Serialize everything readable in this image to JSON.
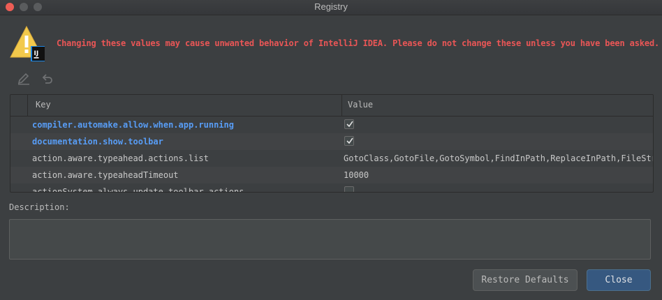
{
  "window": {
    "title": "Registry"
  },
  "warning": {
    "text": "Changing these values may cause unwanted behavior of IntelliJ IDEA. Please do not change these unless you have been asked.",
    "icon": "warning-idea-icon",
    "badge_text": "IJ"
  },
  "toolbar": {
    "edit_icon": "pencil-icon",
    "undo_icon": "undo-icon"
  },
  "table": {
    "columns": {
      "key": "Key",
      "value": "Value"
    },
    "rows": [
      {
        "key": "compiler.automake.allow.when.app.running",
        "value_type": "checkbox",
        "checked": true,
        "modified": true
      },
      {
        "key": "documentation.show.toolbar",
        "value_type": "checkbox",
        "checked": true,
        "modified": true
      },
      {
        "key": "action.aware.typeahead.actions.list",
        "value_type": "text",
        "value": "GotoClass,GotoFile,GotoSymbol,FindInPath,ReplaceInPath,FileStru"
      },
      {
        "key": "action.aware.typeaheadTimeout",
        "value_type": "text",
        "value": "10000"
      },
      {
        "key": "actionSystem.always.update.toolbar.actions",
        "value_type": "checkbox",
        "checked": false
      }
    ]
  },
  "description": {
    "label": "Description:",
    "value": ""
  },
  "buttons": {
    "restore": "Restore Defaults",
    "close": "Close"
  },
  "colors": {
    "warning": "#ea5656",
    "modified_key": "#589df6",
    "background": "#3c3f41",
    "primary_button": "#365880"
  }
}
